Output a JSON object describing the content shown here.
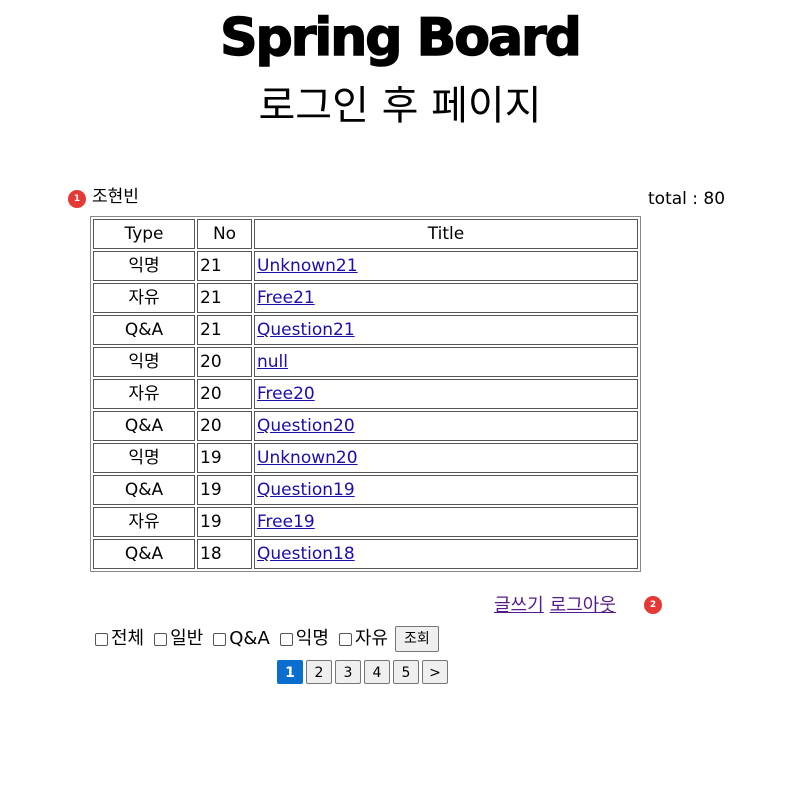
{
  "header": {
    "title": "Spring Board",
    "subtitle": "로그인 후 페이지"
  },
  "user": {
    "name": "조현빈",
    "total_text": "total : 80"
  },
  "badges": [
    "1",
    "2"
  ],
  "table": {
    "headers": [
      "Type",
      "No",
      "Title"
    ],
    "rows": [
      {
        "type": "익명",
        "no": "21",
        "title": "Unknown21"
      },
      {
        "type": "자유",
        "no": "21",
        "title": "Free21"
      },
      {
        "type": "Q&A",
        "no": "21",
        "title": "Question21"
      },
      {
        "type": "익명",
        "no": "20",
        "title": "null"
      },
      {
        "type": "자유",
        "no": "20",
        "title": "Free20"
      },
      {
        "type": "Q&A",
        "no": "20",
        "title": "Question20"
      },
      {
        "type": "익명",
        "no": "19",
        "title": "Unknown20"
      },
      {
        "type": "Q&A",
        "no": "19",
        "title": "Question19"
      },
      {
        "type": "자유",
        "no": "19",
        "title": "Free19"
      },
      {
        "type": "Q&A",
        "no": "18",
        "title": "Question18"
      }
    ]
  },
  "actions": {
    "write": "글쓰기",
    "logout": "로그아웃"
  },
  "filters": {
    "options": [
      "전체",
      "일반",
      "Q&A",
      "익명",
      "자유"
    ],
    "search_button": "조회"
  },
  "pagination": {
    "pages": [
      "1",
      "2",
      "3",
      "4",
      "5"
    ],
    "next": ">",
    "current": "1"
  },
  "colors": {
    "link": "#1a0dab",
    "visited_link": "#551a8b",
    "active_page": "#0a6ed1",
    "badge": "#e53935"
  }
}
